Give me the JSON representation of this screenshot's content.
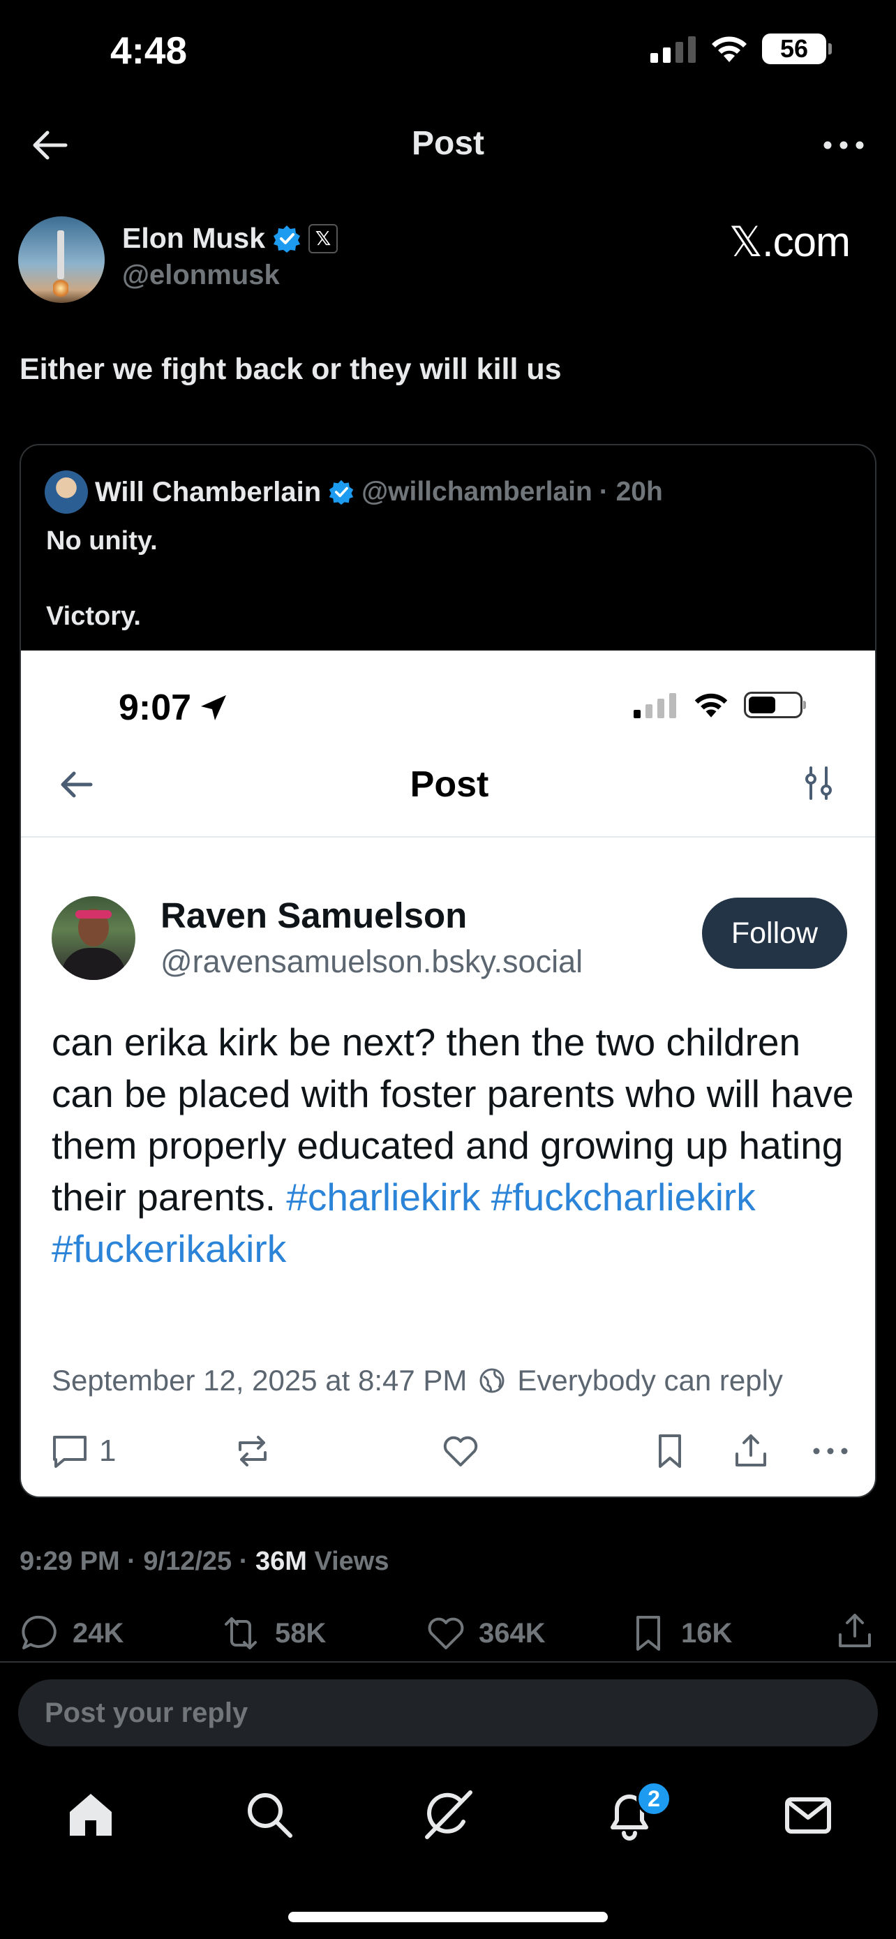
{
  "status_bar": {
    "time": "4:48",
    "battery": "56"
  },
  "header": {
    "title": "Post"
  },
  "post": {
    "author_name": "Elon Musk",
    "author_handle": "@elonmusk",
    "badge_x": "𝕏",
    "source_logo": "𝕏.com",
    "text": "Either we fight back or they will kill us"
  },
  "quote": {
    "name": "Will Chamberlain",
    "handle": "@willchamberlain",
    "time": "· 20h",
    "line1": "No unity.",
    "line2": "Victory.",
    "screenshot": {
      "time": "9:07",
      "title": "Post",
      "name": "Raven Samuelson",
      "handle": "@ravensamuelson.bsky.social",
      "follow_label": "Follow",
      "body": "can erika kirk be next? then the two children can be placed with foster parents who will have them properly educated and growing up hating their parents.",
      "hashtags": [
        "#charliekirk",
        "#fuckcharliekirk",
        "#fuckerikakirk"
      ],
      "date": "September 12, 2025 at 8:47 PM",
      "reply_setting": "Everybody can reply",
      "reply_count": "1"
    }
  },
  "timestamp": {
    "time": "9:29 PM · 9/12/25 ·",
    "views_count": "36M",
    "views_label": "Views"
  },
  "metrics": {
    "replies": "24K",
    "reposts": "58K",
    "likes": "364K",
    "bookmarks": "16K"
  },
  "reply_box": {
    "placeholder": "Post your reply"
  },
  "tabbar": {
    "notifications_badge": "2"
  },
  "colors": {
    "accent": "#1d9bf0",
    "background": "#000000",
    "secondary_text": "#71767b",
    "hashtag": "#2b84d8",
    "follow_button": "#243447"
  }
}
